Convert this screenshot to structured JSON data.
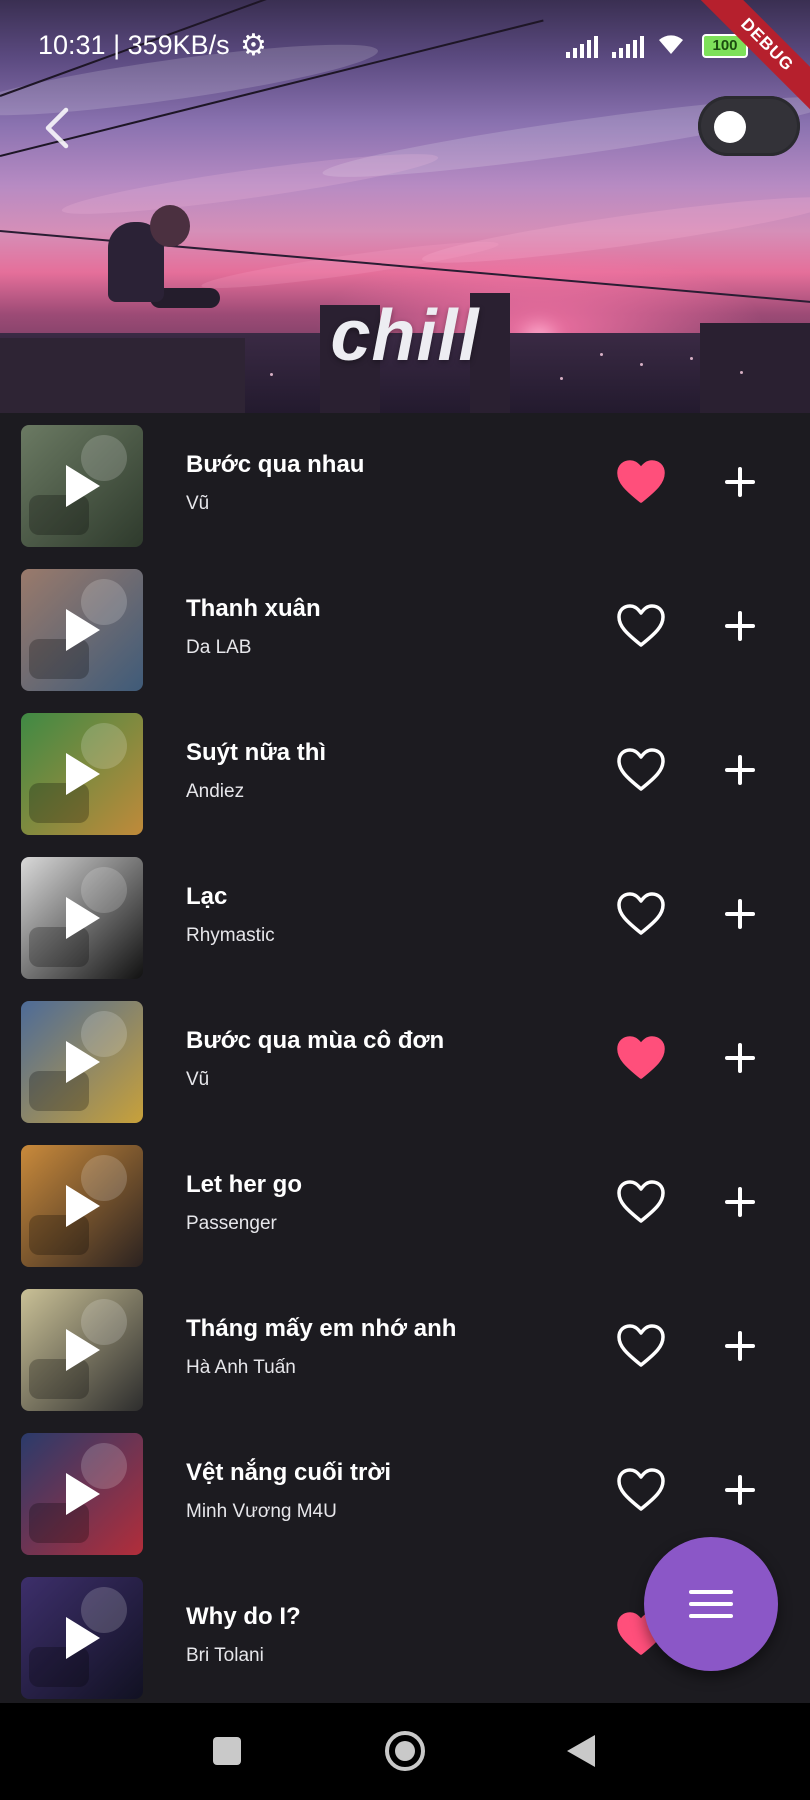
{
  "status_bar": {
    "time_speed": "10:31 | 359KB/s",
    "battery": "100",
    "debug_banner": "DEBUG"
  },
  "hero": {
    "title": "chill"
  },
  "songs": [
    {
      "title": "Bước qua nhau",
      "artist": "Vũ",
      "liked": true,
      "thumb_colors": [
        "#6b7a63",
        "#2e3a2c"
      ]
    },
    {
      "title": "Thanh xuân",
      "artist": "Da LAB",
      "liked": false,
      "thumb_colors": [
        "#9a7a6b",
        "#3f5b79"
      ]
    },
    {
      "title": "Suýt nữa thì",
      "artist": "Andiez",
      "liked": false,
      "thumb_colors": [
        "#3f8a44",
        "#c08a3a"
      ]
    },
    {
      "title": "Lạc",
      "artist": "Rhymastic",
      "liked": false,
      "thumb_colors": [
        "#d9d9d9",
        "#111111"
      ]
    },
    {
      "title": "Bước qua mùa cô đơn",
      "artist": "Vũ",
      "liked": true,
      "thumb_colors": [
        "#4d6b98",
        "#c8a13a"
      ]
    },
    {
      "title": "Let her go",
      "artist": "Passenger",
      "liked": false,
      "thumb_colors": [
        "#c98a3b",
        "#2b2220"
      ]
    },
    {
      "title": "Tháng mấy em nhớ anh",
      "artist": "Hà Anh Tuấn",
      "liked": false,
      "thumb_colors": [
        "#c9c096",
        "#2d2d2d"
      ]
    },
    {
      "title": "Vệt nắng cuối trời",
      "artist": "Minh Vương M4U",
      "liked": false,
      "thumb_colors": [
        "#2a3b6b",
        "#b22d3a"
      ]
    },
    {
      "title": "Why do I?",
      "artist": "Bri Tolani",
      "liked": true,
      "thumb_colors": [
        "#3d2f6b",
        "#111122"
      ]
    }
  ],
  "colors": {
    "background": "#1c1b20",
    "heart_active": "#ff4f7b",
    "fab": "#8b57c7",
    "navbar": "#000000"
  },
  "icons": {
    "back": "chevron-left-icon",
    "toggle": "toggle-switch",
    "play": "play-icon",
    "heart": "heart-icon",
    "add": "plus-icon",
    "menu": "menu-icon",
    "nav_recents": "square-icon",
    "nav_home": "circle-icon",
    "nav_back": "triangle-back-icon"
  }
}
